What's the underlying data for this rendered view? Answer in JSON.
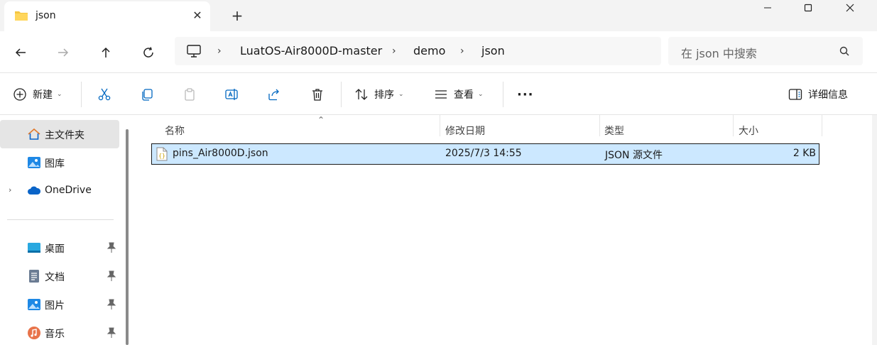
{
  "tab": {
    "title": "json",
    "close": "✕"
  },
  "window": {
    "new_tab": "+"
  },
  "address": {
    "crumbs": [
      "LuatOS-Air8000D-master",
      "demo",
      "json"
    ],
    "sep": "›"
  },
  "search": {
    "placeholder": "在 json 中搜索"
  },
  "toolbar": {
    "new_label": "新建",
    "sort_label": "排序",
    "view_label": "查看",
    "more_label": "···",
    "details_label": "详细信息",
    "chevron": "⌄"
  },
  "sidebar": {
    "items": [
      {
        "label": "主文件夹",
        "icon": "home-icon"
      },
      {
        "label": "图库",
        "icon": "gallery-icon"
      },
      {
        "label": "OneDrive",
        "icon": "cloud-icon"
      },
      {
        "label": "桌面",
        "icon": "desktop-icon"
      },
      {
        "label": "文档",
        "icon": "document-icon"
      },
      {
        "label": "图片",
        "icon": "pictures-icon"
      },
      {
        "label": "音乐",
        "icon": "music-icon"
      }
    ],
    "expand": "›"
  },
  "table": {
    "columns": [
      "名称",
      "修改日期",
      "类型",
      "大小"
    ],
    "sort_caret": "⌃",
    "rows": [
      {
        "name": "pins_Air8000D.json",
        "date": "2025/7/3 14:55",
        "type": "JSON 源文件",
        "size": "2 KB"
      }
    ]
  },
  "colors": {
    "selection": "#cce8ff",
    "folder": "#f4c542",
    "accent": "#0067c0"
  }
}
